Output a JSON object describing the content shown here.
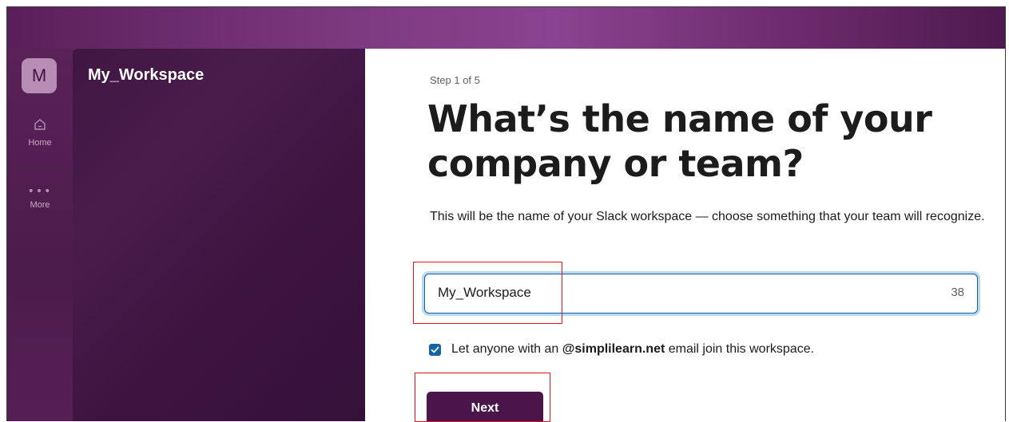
{
  "workspace": {
    "initial": "M",
    "name": "My_Workspace"
  },
  "rail": {
    "home_label": "Home",
    "more_label": "More",
    "more_glyph": "•••"
  },
  "form": {
    "step": "Step 1 of 5",
    "heading": "What’s the name of your company or team?",
    "description": "This will be the name of your Slack workspace — choose something that your team will recognize.",
    "input_value": "My_Workspace",
    "char_count": "38",
    "checkbox_checked": true,
    "checkbox_label_prefix": "Let anyone with an ",
    "checkbox_domain": "@simplilearn.net",
    "checkbox_label_suffix": " email join this workspace.",
    "next_label": "Next"
  },
  "colors": {
    "brand": "#4a154b",
    "accent": "#1264a3",
    "highlight": "#e3131b"
  }
}
